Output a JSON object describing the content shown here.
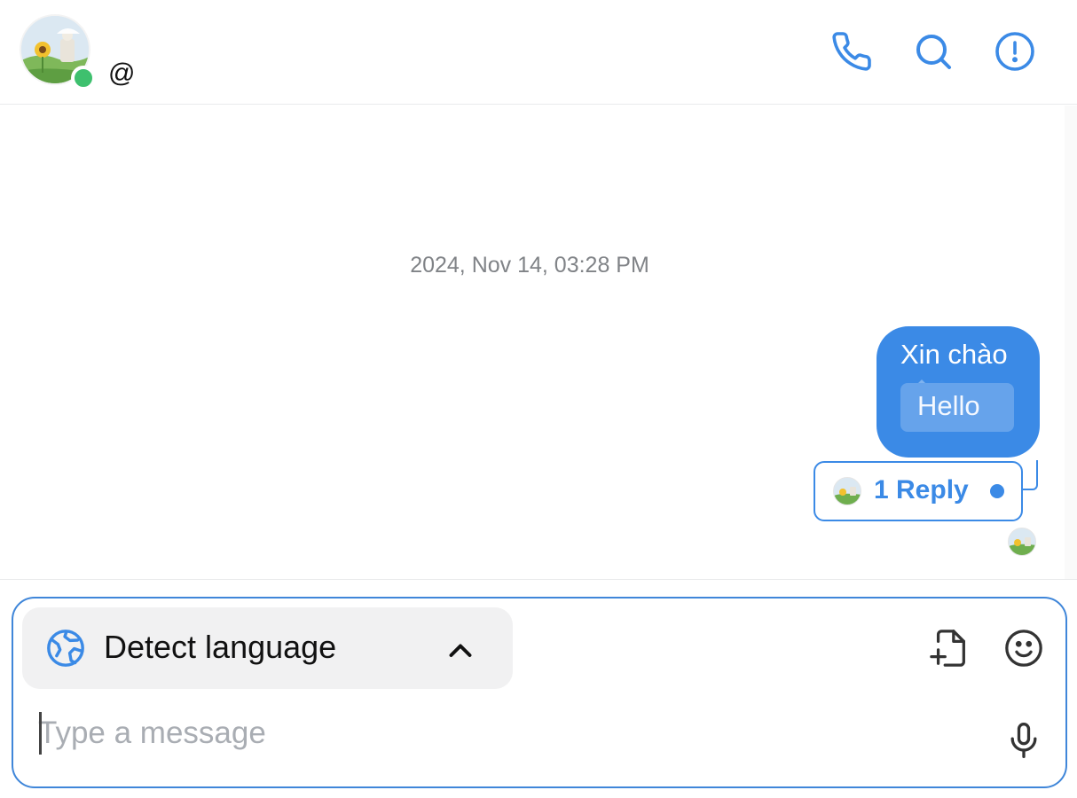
{
  "header": {
    "handle": "@",
    "online": true,
    "actions": [
      "phone-icon",
      "search-icon",
      "info-icon"
    ]
  },
  "conversation": {
    "timestamp": "2024, Nov 14, 03:28 PM",
    "messages": [
      {
        "direction": "outgoing",
        "text": "Xin chào",
        "translation": "Hello",
        "thread": {
          "label": "1 Reply",
          "unread": true
        }
      }
    ]
  },
  "composer": {
    "language_label": "Detect language",
    "placeholder": "Type a message",
    "value": "",
    "actions": [
      "attach-file-icon",
      "emoji-icon",
      "microphone-icon"
    ]
  },
  "colors": {
    "accent": "#3b8ae6",
    "online": "#3ec06e",
    "language_panel": "#f1f1f2",
    "timestamp": "#808387",
    "placeholder": "#a9adb3"
  }
}
